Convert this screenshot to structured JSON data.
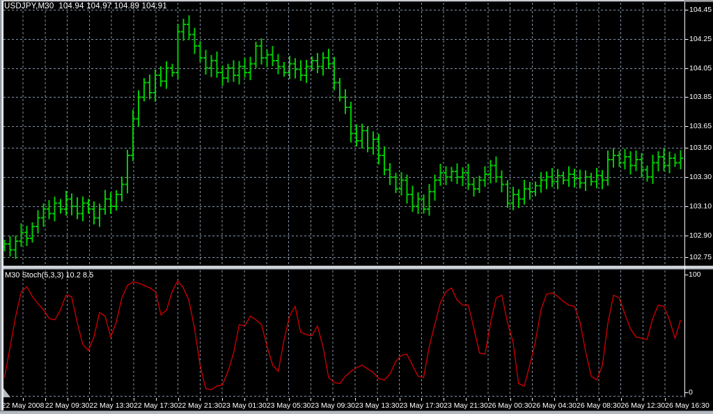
{
  "chart": {
    "symbol_label": "USDJPY,M30  104.94 104.97 104.89 104.91",
    "price_axis": {
      "labels": [
        "104.45",
        "104.25",
        "104.05",
        "103.85",
        "103.65",
        "103.50",
        "103.30",
        "103.10",
        "102.90",
        "102.75"
      ],
      "values": [
        104.45,
        104.25,
        104.05,
        103.85,
        103.65,
        103.5,
        103.3,
        103.1,
        102.9,
        102.75
      ]
    },
    "time_axis": {
      "labels": [
        "22 May 2008",
        "22 May 09:30",
        "22 May 13:30",
        "22 May 17:30",
        "22 May 21:30",
        "23 May 01:30",
        "23 May 05:30",
        "23 May 09:30",
        "23 May 13:30",
        "23 May 17:30",
        "23 May 21:30",
        "26 May 00:30",
        "26 May 04:30",
        "26 May 08:30",
        "26 May 12:30",
        "26 May 16:30"
      ]
    },
    "colors": {
      "background": "#000000",
      "grid": "#8596A8",
      "bar_green": "#00CC00",
      "indicator_red": "#D40000",
      "text": "#FFFFFF",
      "axis_line": "#FFFFFF",
      "frame_light": "#B4B9BF",
      "frame_white": "#F0F2F4",
      "frame_dark": "#7E858D"
    }
  },
  "indicator": {
    "label": "M30 Stoch(5,3,3) 10.2 8.5",
    "scale_max": "100",
    "scale_min": "0"
  },
  "chart_data": [
    {
      "type": "ohlc_bars",
      "title": "USDJPY M30 price pane",
      "x_tick_labels": [
        "22 May 2008",
        "22 May 09:30",
        "22 May 13:30",
        "22 May 17:30",
        "22 May 21:30",
        "23 May 01:30",
        "23 May 05:30",
        "23 May 09:30",
        "23 May 13:30",
        "23 May 17:30",
        "23 May 21:30",
        "26 May 00:30",
        "26 May 04:30",
        "26 May 08:30",
        "26 May 12:30",
        "26 May 16:30"
      ],
      "price_gridlines": [
        104.45,
        104.25,
        104.05,
        103.85,
        103.65,
        103.5,
        103.3,
        103.1,
        102.9,
        102.75
      ],
      "ylim": [
        102.7,
        104.5
      ],
      "grid": "dashed",
      "bar_interval_minutes": 30,
      "closes": [
        102.84,
        102.8,
        102.86,
        102.92,
        102.88,
        102.96,
        103.02,
        103.08,
        103.05,
        103.12,
        103.08,
        103.15,
        103.1,
        103.05,
        103.12,
        103.08,
        103.02,
        103.08,
        103.15,
        103.1,
        103.18,
        103.25,
        103.45,
        103.7,
        103.85,
        103.95,
        103.88,
        104.0,
        103.96,
        104.05,
        104.02,
        104.3,
        104.35,
        104.28,
        104.2,
        104.12,
        104.05,
        104.1,
        104.02,
        103.98,
        104.05,
        104.0,
        104.06,
        104.02,
        104.08,
        104.2,
        104.12,
        104.14,
        104.1,
        104.06,
        104.02,
        104.08,
        104.04,
        104.0,
        104.06,
        104.1,
        104.06,
        104.12,
        104.08,
        103.95,
        103.85,
        103.78,
        103.6,
        103.55,
        103.62,
        103.5,
        103.56,
        103.45,
        103.35,
        103.3,
        103.22,
        103.28,
        103.18,
        103.1,
        103.15,
        103.08,
        103.2,
        103.28,
        103.33,
        103.3,
        103.34,
        103.3,
        103.33,
        103.25,
        103.22,
        103.28,
        103.32,
        103.38,
        103.3,
        103.25,
        103.12,
        103.18,
        103.15,
        103.22,
        103.2,
        103.24,
        103.28,
        103.3,
        103.27,
        103.31,
        103.28,
        103.32,
        103.29,
        103.26,
        103.3,
        103.27,
        103.31,
        103.28,
        103.42,
        103.45,
        103.4,
        103.44,
        103.38,
        103.42,
        103.35,
        103.3,
        103.4,
        103.44,
        103.38,
        103.43,
        103.4,
        103.43
      ],
      "ohlc_estimation_note": "bars drawn with open = previous close, wicks ~0.03-0.06 beyond body (values estimated from pixels)"
    },
    {
      "type": "line",
      "name": "Stoch(5,3,3)",
      "current_values_label": "10.2 8.5",
      "ylim": [
        0,
        100
      ],
      "scale_labels": [
        "100",
        "0"
      ],
      "values": [
        15,
        40,
        65,
        85,
        89,
        81,
        75,
        70,
        63,
        62,
        70,
        82,
        81,
        60,
        42,
        37,
        48,
        68,
        65,
        48,
        60,
        80,
        90,
        93,
        92,
        90,
        88,
        85,
        66,
        70,
        85,
        94,
        88,
        78,
        55,
        25,
        6,
        5,
        8,
        9,
        20,
        35,
        58,
        57,
        65,
        62,
        58,
        40,
        25,
        20,
        45,
        65,
        73,
        52,
        50,
        49,
        57,
        40,
        15,
        11,
        10,
        16,
        20,
        23,
        25,
        22,
        19,
        14,
        13,
        18,
        28,
        33,
        34,
        25,
        16,
        15,
        40,
        58,
        76,
        85,
        88,
        78,
        74,
        74,
        55,
        35,
        34,
        60,
        80,
        82,
        60,
        44,
        10,
        8,
        25,
        44,
        70,
        83,
        84,
        81,
        77,
        74,
        73,
        60,
        36,
        16,
        13,
        25,
        60,
        82,
        80,
        67,
        55,
        48,
        47,
        46,
        63,
        74,
        73,
        62,
        47,
        62
      ]
    }
  ]
}
